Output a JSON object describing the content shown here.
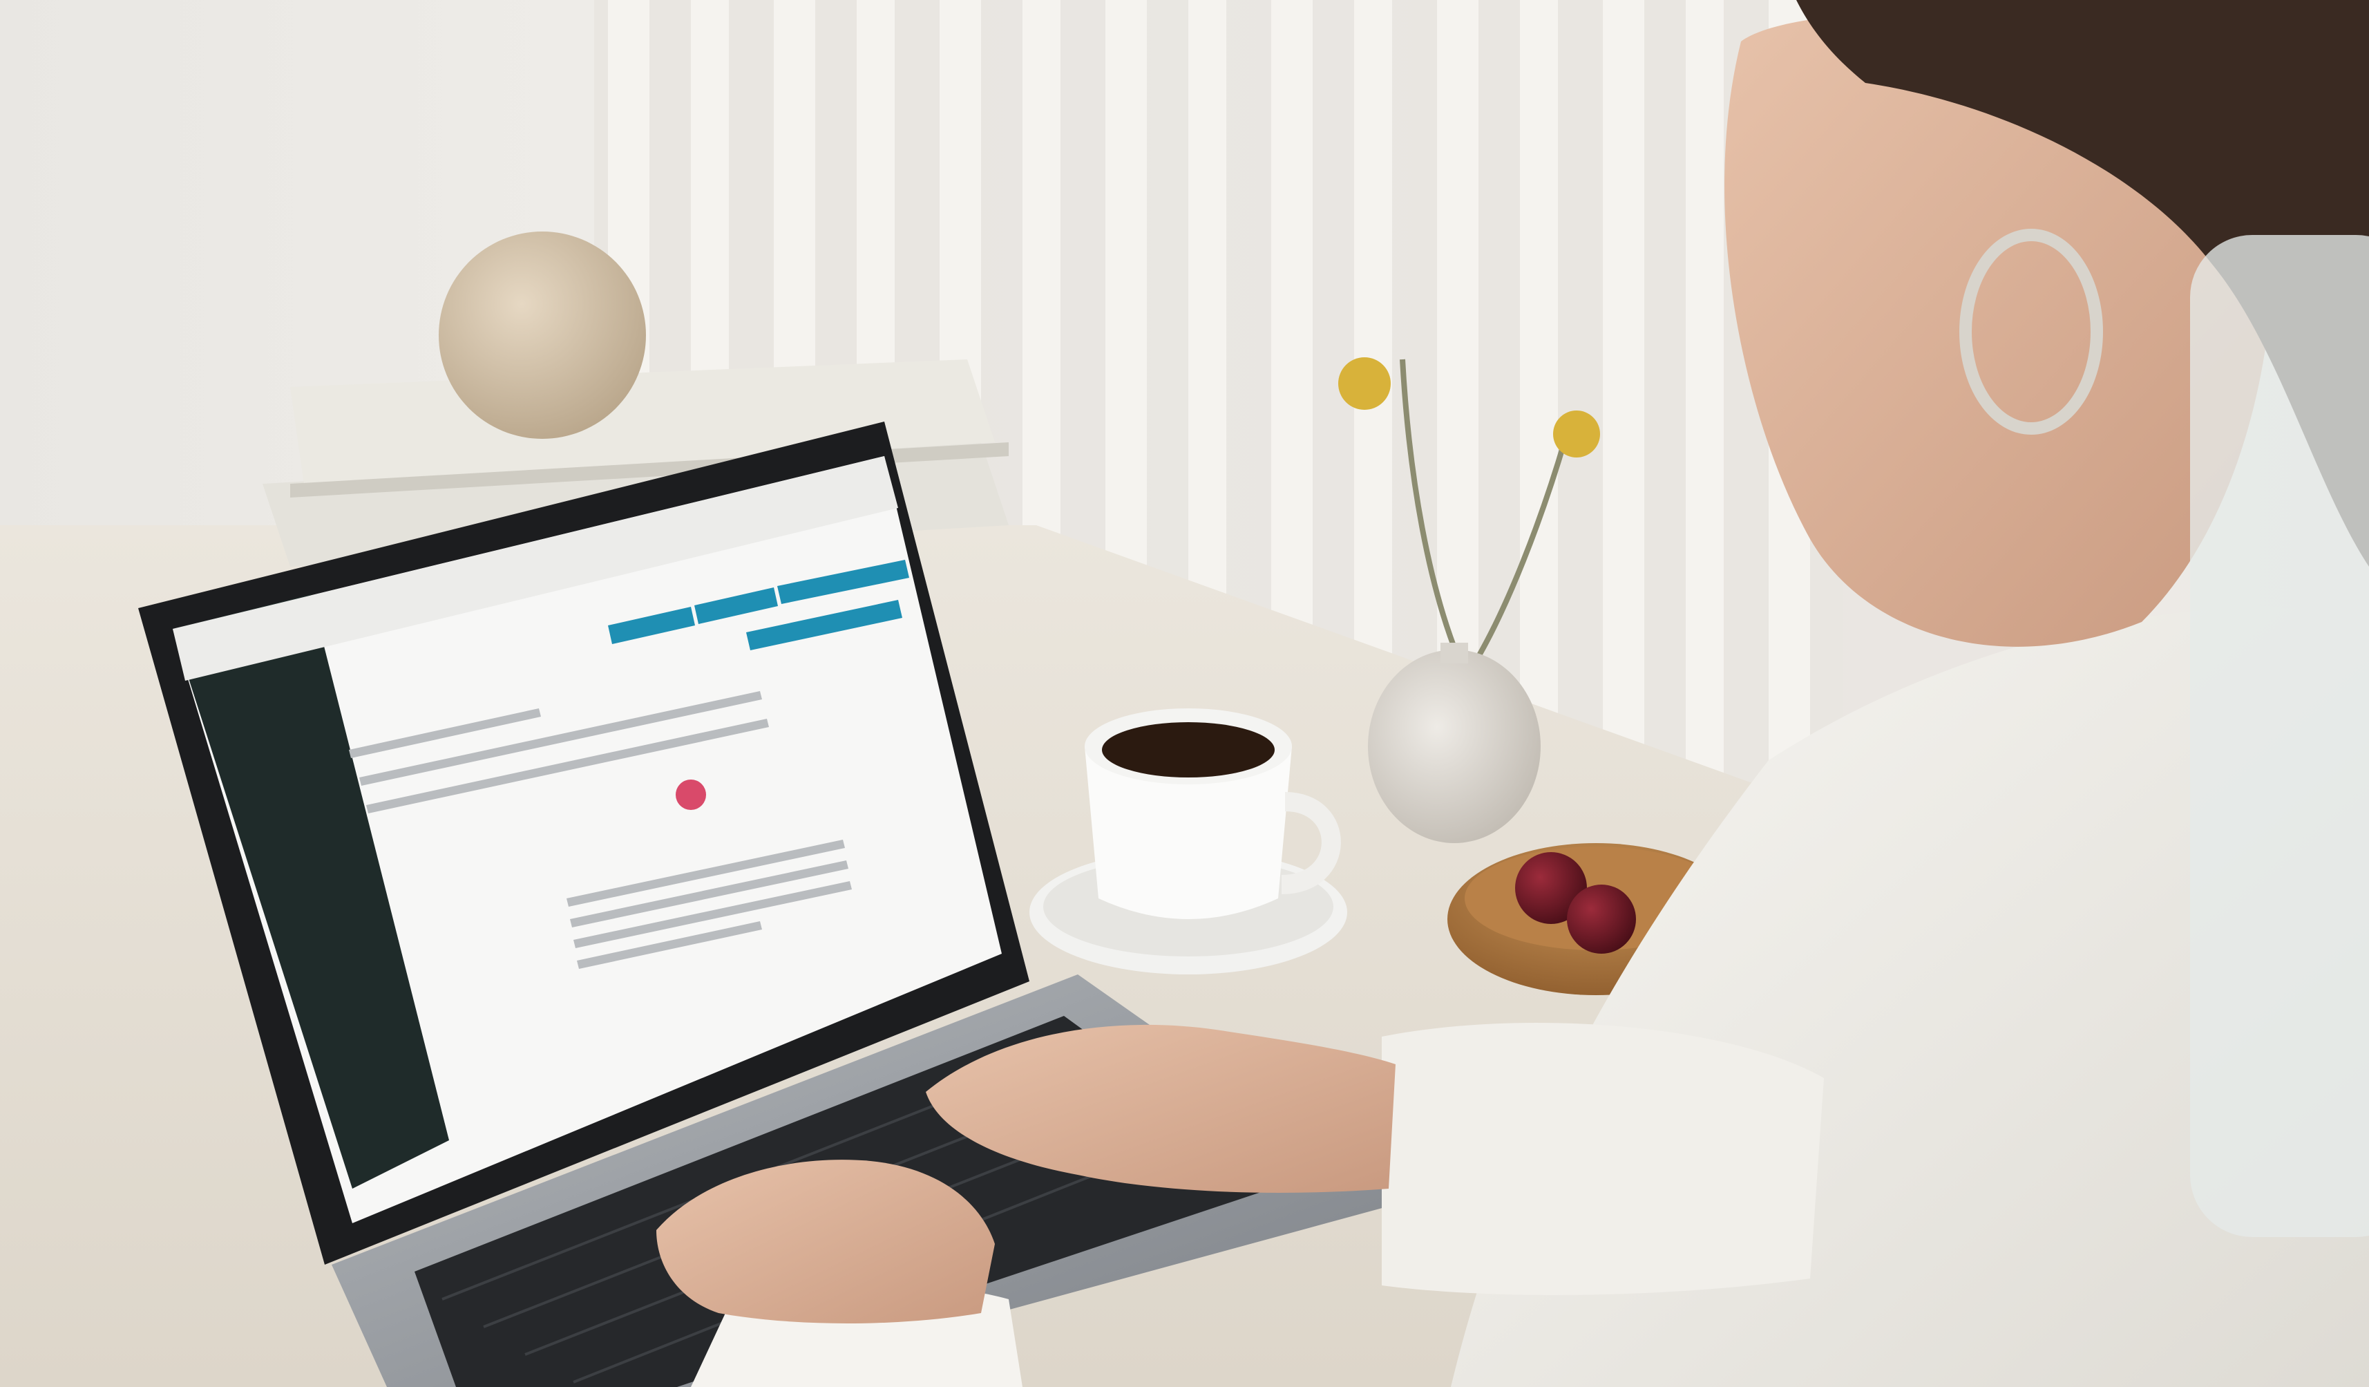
{
  "photo": {
    "scene": "workspace-photo",
    "colors": {
      "wall": "#f1efeb",
      "curtain": "#e6e3de",
      "desk": "#e9e3d9",
      "laptop_body": "#9a9ea3",
      "laptop_bezel": "#1c1d1f",
      "screen_bg": "#f7f7f6",
      "sidebar": "#1f2b2a",
      "accent_buttons": "#1f8fb3",
      "sweater": "#f3f1ec",
      "skin": "#dcb39a",
      "hair": "#3a2a22",
      "bowl": "#a8743f",
      "cherries": "#5e1420",
      "flower": "#d8b23a",
      "vase": "#d9d5ce",
      "mug": "#fbfbfa",
      "coffee": "#2b1a10",
      "frosted_panel": "#e6ebe9"
    },
    "icons": [
      "laptop-icon",
      "coffee-cup-icon",
      "vase-icon",
      "bowl-icon",
      "sphere-icon"
    ]
  }
}
